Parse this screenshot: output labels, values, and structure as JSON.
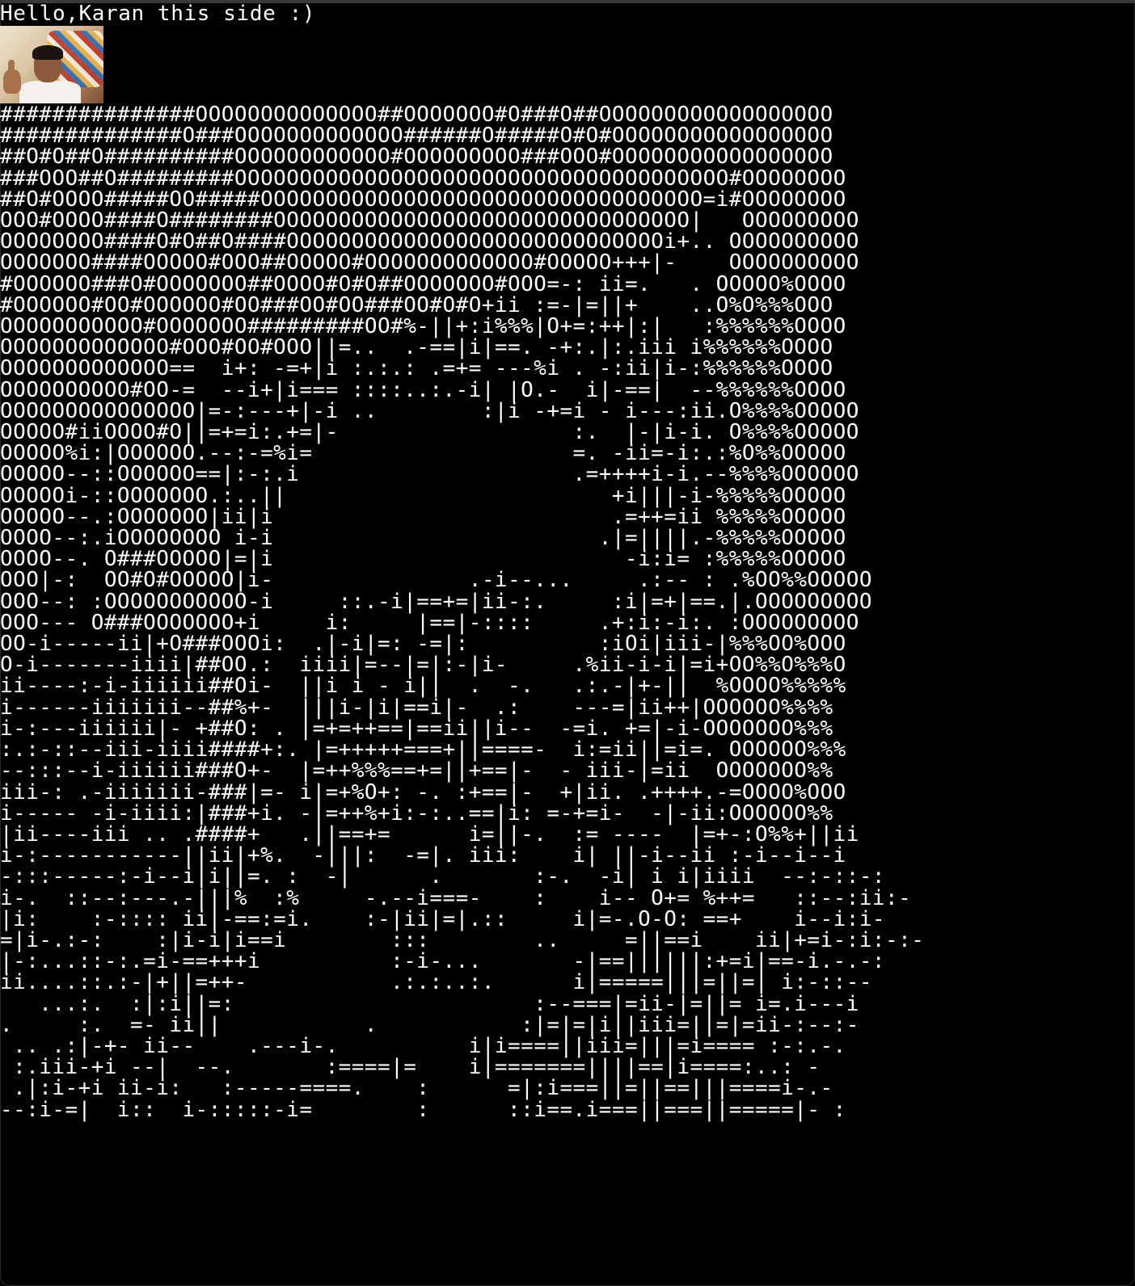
{
  "terminal": {
    "greeting": "Hello,Karan this side :)",
    "thumbnail_alt": "webcam preview",
    "ascii_lines": [
      "###############OOOOOOOOOOOOOO##OOOOOOO#O###O##OOOOOOOOOOOOOOOOOO",
      "##############O###OOOOOOOOOOOOO######O#####O#O#OOOOOOOOOOOOOOOOO",
      "##O#O##O##########OOOOOOOOOOOO#OOOOOOOOO###OOO#OOOOOOOOOOOOOOOOO",
      "###OOO##O#########OOOOOOOOOOOOOOOOOOOOOOOOOOOOOOOOOOOOOO#OOOOOOOO",
      "##O#OOOO#####OO#####OOOOOOOOOOOOOOOOOOOOOOOOOOOOOOOOOO=i#OOOOOOOO",
      "OOO#OOOO####O########OOOOOOOOOOOOOOOOOOOOOOOOOOOOOOOO|   OOOOOOOOO",
      "OOOOOOOO####O#O##O####OOOOOOOOOOOOOOOOOOOOOOOOOOOOOi+.. OOOOOOOOOO",
      "OOOOOOO####OOOOO#OOO##OOOOO#OOOOOOOOOOOOO#OOOOO+++|-    OOOOOOOOOO",
      "#OOOOOO###O#OOOOOOO##OOOO#O#O##OOOOOOO#OOO=-: ii=.   . OOOOO%OOOO",
      "#OOOOOO#OO#OOOOOO#OO###OO#OO###OO#O#O+ii :=-|=||+    ..O%O%%%OOO",
      "OOOOOOOOOOO#OOOOOOO#########OO#%-||+:i%%%|O+=:++|:|   :%%%%%%OOOO",
      "OOOOOOOOOOOOO#OOO#OO#OOO||=..  .-==|i|==. -+:.|:.iii i%%%%%%OOOO",
      "OOOOOOOOOOOOO==  i+: -=+|i :.:.: .=+= ---%i . -:ii|i-:%%%%%%OOOO",
      "OOOOOOOOOO#OO-=  --i+|i=== ::::..:.-i| |O.-  i|-==|  --%%%%%%OOOO",
      "OOOOOOOOOOOOOOO|=-:---+|-i ..        :|i -+=i - i---:ii.O%%%%OOOOO",
      "OOOOO#iiOOOO#O||=+=i:.+=|-                  :.  |-|i-i. O%%%%OOOOO",
      "OOOOO%i:|OOOOOO.--:-=%i=                    =. -ii=-i:.:%O%%OOOOO",
      "OOOOO--::OOOOOO==|:-:.i                     .=++++i-i.--%%%%OOOOOO",
      "OOOOOi-::OOOOOOO.:..||                         +i|||-i-%%%%%OOOOO",
      "OOOOO--.:OOOOOOO|ii|i                          .=++=ii %%%%%OOOOO",
      "OOOO--:.iOOOOOOOO i-i                         .|=||||.-%%%%%OOOOO",
      "OOOO--. O###OOOOO|=|i                           -i:i= :%%%%%OOOOO",
      "OOO|-:  OO#O#OOOOO|i-               .-i--...     .:-- : .%OO%%OOOOO",
      "OOO--: :OOOOOOOOOOO-i     ::.-i|==+=|ii-:.     :i|=+|==.|.OOOOOOOOO",
      "OOO--- O###OOOOOOO+i     i:     |==|-::::     .+:i:-i:. :OOOOOOOOO",
      "OO-i-----ii|+O###OOOi:  .|-i|=: -=|:          :iOi|iii-|%%%OO%OOO",
      "O-i-------iiii|##OO.:  iiii|=--|=|:-|i-     .%ii-i-i|=i+OO%%O%%%O",
      "ii----:-i-iiiiii##Oi-  ||i i - i||  .  -.   .:.-|+-||  %OOOO%%%%%",
      "i------iiiiiii--##%+-  |||i-|i|==i|-  .:    ---=|ii++|OOOOOO%%%%",
      "i-:---iiiiii|- +##O: . |=+=++==|==ii||i--  -=i. +=|-i-OOOOOOO%%%",
      ":.:-::--iii-iiii####+:. |=+++++===+||====-  i:=ii||=i=. OOOOOO%%%",
      "--:::--i-iiiiii###O+-  |=++%%%==+=||+==|-  - iii-|=ii  OOOOOOO%%",
      "iii-: .-iiiiiii-###|=- i|=+%O+: -. :+==|-  +|ii. .++++.-=OOOO%OOO",
      "i----- -i-iiii:|###+i. -|=++%+i:-:..==|i: =-+=i-  -|-ii:OOOOOO%%",
      "|ii----iii .. .####+   .||==+=      i=||-.  := ----  |=+-:O%%+||ii",
      "i-:-----------||ii|+%.  -|||:  -=|. iii:    i| ||-i--ii :-i--i--i",
      "-:::-----:-i--i|i||=. :  -|      .       :-.  -i| i i|iiii  --:-::-:",
      "i-.  ::--:---.-|||%  :%     -.--i===-    :    i-- O+= %++=   ::--:ii:-",
      "|i:    :-:::: ii|-==:=i.    :-|ii|=|.::     i|=-.O-O: ==+    i--i:i-",
      "=|i-.:-:    :|i-i|i==i        :::        ..     =||==i    ii|+=i-:i:-:-",
      "|-:...::-:.=i-==+++i          :-i-...       -|==||||||:+=i|==-i.-.-:",
      "ii....::.:-|+||=++-           .:.:..:.      i|=====|||=||=| i:-::--",
      "   ...:.  :|:i||=:                       :--===|=ii-|=||= i=.i---i",
      ".     :.  =- ii||           .           :|=|=|i||iii=||=|=ii-:--:-",
      " .. .:|-+- ii--    .---i-.          i|i====||iii=|||=i==== :-:.-.",
      " :.iii-+i --|  --.       :====|=    i|=======||||==|i====:..: -",
      " .|:i-+i ii-i:   :-----====.    :      =|:i===||=||==|||====i-.-",
      "--:i-=|  i::  i-:::::-i=        :      ::i==.i===||===||=====|- :"
    ]
  }
}
